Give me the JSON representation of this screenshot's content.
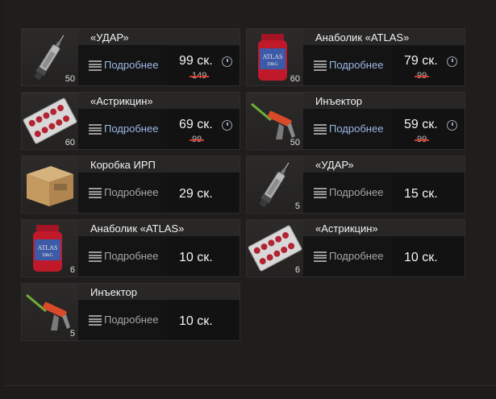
{
  "items": [
    {
      "title": "«УДАР»",
      "count": "50",
      "details": "Подробнее",
      "price": "99 ск.",
      "old_price": "149",
      "icon": "syringe-icon",
      "timer": true,
      "active": true
    },
    {
      "title": "Анаболик «ATLAS»",
      "count": "60",
      "details": "Подробнее",
      "price": "79 ск.",
      "old_price": "99",
      "icon": "atlas-jar-icon",
      "timer": true,
      "active": true
    },
    {
      "title": "«Астрикцин»",
      "count": "60",
      "details": "Подробнее",
      "price": "69 ск.",
      "old_price": "99",
      "icon": "pill-blister-icon",
      "timer": true,
      "active": true
    },
    {
      "title": "Инъектор",
      "count": "50",
      "details": "Подробнее",
      "price": "59 ск.",
      "old_price": "99",
      "icon": "injector-icon",
      "timer": true,
      "active": true
    },
    {
      "title": "Коробка ИРП",
      "count": "",
      "details": "Подробнее",
      "price": "29 ск.",
      "old_price": "",
      "icon": "cardboard-box-icon",
      "timer": false,
      "active": false
    },
    {
      "title": "«УДАР»",
      "count": "5",
      "details": "Подробнее",
      "price": "15 ск.",
      "old_price": "",
      "icon": "syringe-icon",
      "timer": false,
      "active": false
    },
    {
      "title": "Анаболик «ATLAS»",
      "count": "6",
      "details": "Подробнее",
      "price": "10 ск.",
      "old_price": "",
      "icon": "atlas-jar-icon",
      "timer": false,
      "active": false
    },
    {
      "title": "«Астрикцин»",
      "count": "6",
      "details": "Подробнее",
      "price": "10 ск.",
      "old_price": "",
      "icon": "pill-blister-icon",
      "timer": false,
      "active": false
    },
    {
      "title": "Инъектор",
      "count": "5",
      "details": "Подробнее",
      "price": "10 ск.",
      "old_price": "",
      "icon": "injector-icon",
      "timer": false,
      "active": false
    }
  ],
  "jar_label": "ATLAS",
  "jar_sublabel": "D&G",
  "colors": {
    "details_active": "#9eb6e6",
    "details_inactive": "#a6a6a6",
    "strike": "#d23b2b",
    "jar_red": "#c0192a"
  }
}
